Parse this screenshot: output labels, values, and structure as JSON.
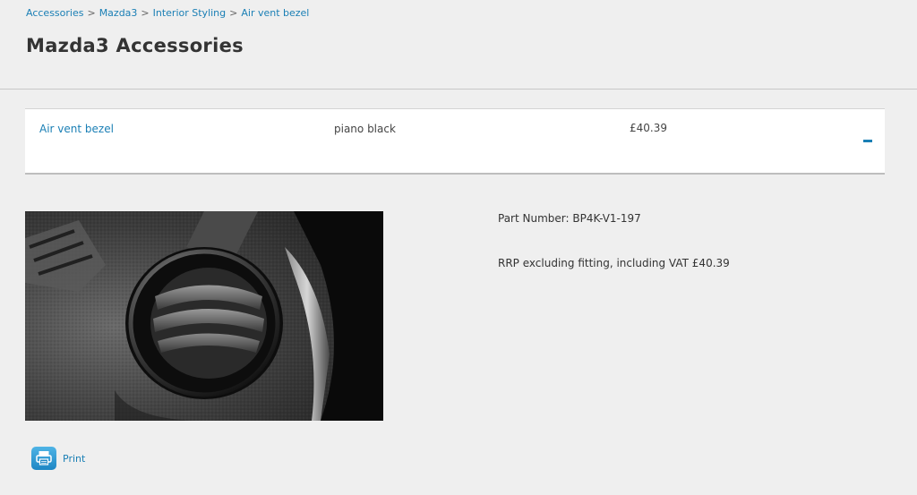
{
  "breadcrumb": {
    "items": [
      "Accessories",
      "Mazda3",
      "Interior Styling",
      "Air vent bezel"
    ],
    "separator": ">"
  },
  "page_title": "Mazda3 Accessories",
  "accessory": {
    "name": "Air vent bezel",
    "finish": "piano black",
    "price": "£40.39",
    "expanded": true,
    "toggle_icon": "minus-icon"
  },
  "details": {
    "part_number": "Part Number: BP4K-V1-197",
    "rrp": "RRP excluding fitting, including VAT £40.39"
  },
  "print": {
    "label": "Print",
    "icon": "printer-icon"
  },
  "colors": {
    "link": "#1a7fb5",
    "background": "#efefef"
  }
}
